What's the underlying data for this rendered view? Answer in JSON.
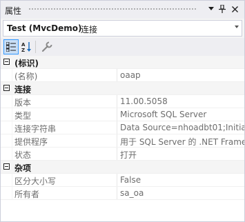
{
  "window": {
    "title": "属性",
    "pin_label": "╫",
    "close_label": "✕"
  },
  "object_selector": {
    "name": "Test (MvcDemo)",
    "type": "连接"
  },
  "groups": [
    {
      "label": "(标识)",
      "properties": [
        {
          "label": "(名称)",
          "value": "oaap"
        }
      ]
    },
    {
      "label": "连接",
      "properties": [
        {
          "label": "版本",
          "value": "11.00.5058"
        },
        {
          "label": "类型",
          "value": "Microsoft SQL Server"
        },
        {
          "label": "连接字符串",
          "value": "Data Source=nhoadbt01;Initia"
        },
        {
          "label": "提供程序",
          "value": "用于 SQL Server 的 .NET Frame"
        },
        {
          "label": "状态",
          "value": "打开"
        }
      ]
    },
    {
      "label": "杂项",
      "properties": [
        {
          "label": "区分大小写",
          "value": "False"
        },
        {
          "label": "所有者",
          "value": "sa_oa"
        }
      ]
    }
  ],
  "colors": {
    "accent": "#3399ff",
    "active_tool_bg": "#c9def5",
    "muted_text": "#6d6d6d",
    "panel_bg": "#eeeef2"
  }
}
